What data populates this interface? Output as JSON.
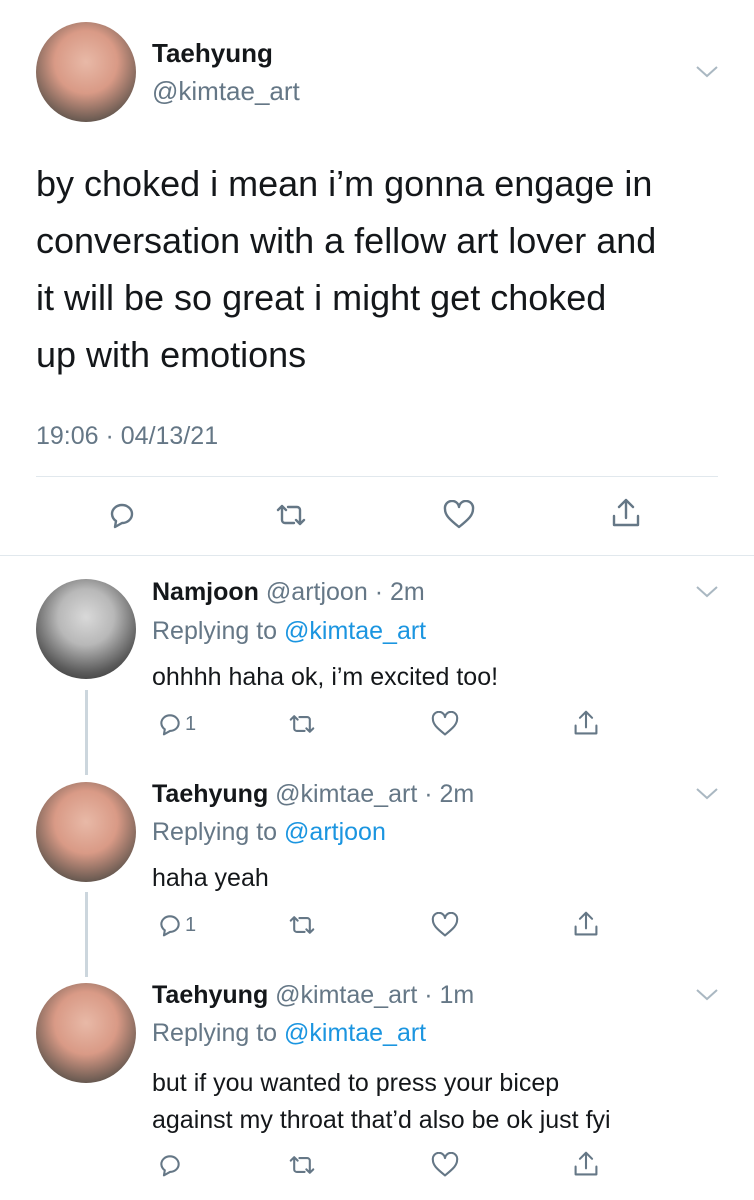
{
  "main_tweet": {
    "author_name": "Taehyung",
    "author_handle": "@kimtae_art",
    "text_lines": [
      "by choked i mean i’m gonna engage in",
      "conversation with a fellow art lover and",
      "it will be so great i might get choked",
      "up with emotions"
    ],
    "timestamp": "19:06 · 04/13/21",
    "actions": [
      "reply-icon",
      "retweet-icon",
      "like-icon",
      "share-icon"
    ]
  },
  "replies": [
    {
      "author_name": "Namjoon",
      "author_handle": "@artjoon",
      "time": "· 2m",
      "replying_label": "Replying to",
      "replying_to": "@kimtae_art",
      "text_lines": [
        "ohhhh haha ok, i’m excited too!"
      ],
      "reply_count": "1"
    },
    {
      "author_name": "Taehyung",
      "author_handle": "@kimtae_art",
      "time": "· 2m",
      "replying_label": "Replying to",
      "replying_to": "@artjoon",
      "text_lines": [
        "haha yeah"
      ],
      "reply_count": "1"
    },
    {
      "author_name": "Taehyung",
      "author_handle": "@kimtae_art",
      "time": "· 1m",
      "replying_label": "Replying to",
      "replying_to": "@kimtae_art",
      "text_lines": [
        "but if you wanted to press your bicep",
        "against my throat that’d also be ok just fyi"
      ],
      "reply_count": ""
    }
  ],
  "colors": {
    "text": "#14171a",
    "muted": "#657786",
    "link": "#1b95e0",
    "divider": "#e1e8ed"
  }
}
